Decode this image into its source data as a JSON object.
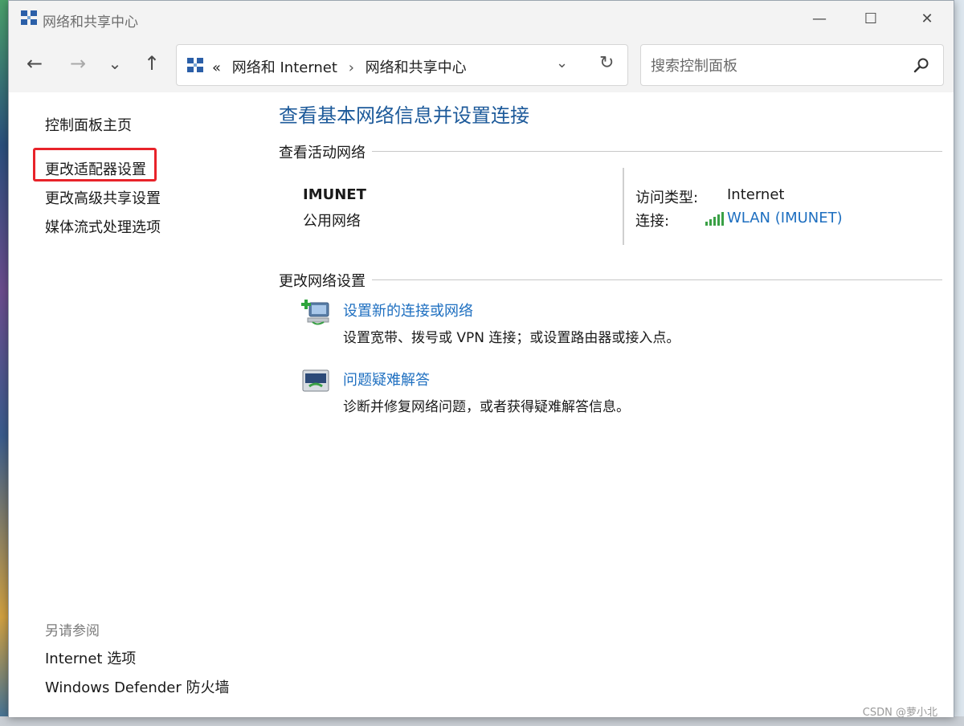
{
  "window": {
    "title": "网络和共享中心",
    "controls": {
      "minimize": "—",
      "maximize": "☐",
      "close": "✕"
    }
  },
  "nav": {
    "back": "←",
    "forward": "→",
    "recent": "⌄",
    "up": "↑"
  },
  "address_bar": {
    "overflow": "«",
    "crumbs": [
      "网络和 Internet",
      "网络和共享中心"
    ],
    "separator": "›",
    "dropdown": "⌄",
    "refresh": "↻"
  },
  "search": {
    "placeholder": "搜索控制面板",
    "value": ""
  },
  "sidebar": {
    "home": "控制面板主页",
    "items": [
      "更改适配器设置",
      "更改高级共享设置",
      "媒体流式处理选项"
    ],
    "see_also_heading": "另请参阅",
    "see_also": [
      "Internet 选项",
      "Windows Defender 防火墙"
    ]
  },
  "main": {
    "title": "查看基本网络信息并设置连接",
    "active_section": "查看活动网络",
    "network": {
      "name": "IMUNET",
      "category": "公用网络",
      "access_label": "访问类型:",
      "access_value": "Internet",
      "conn_label": "连接:",
      "conn_value": "WLAN (IMUNET)"
    },
    "change_section": "更改网络设置",
    "tasks": [
      {
        "icon": "new-connection-icon",
        "title": "设置新的连接或网络",
        "desc": "设置宽带、拨号或 VPN 连接；或设置路由器或接入点。"
      },
      {
        "icon": "troubleshoot-icon",
        "title": "问题疑难解答",
        "desc": "诊断并修复网络问题，或者获得疑难解答信息。"
      }
    ]
  },
  "watermark": "CSDN @萝小北",
  "colors": {
    "link": "#1e6fc0",
    "title": "#1d5a9a",
    "highlight": "#e8232a"
  }
}
